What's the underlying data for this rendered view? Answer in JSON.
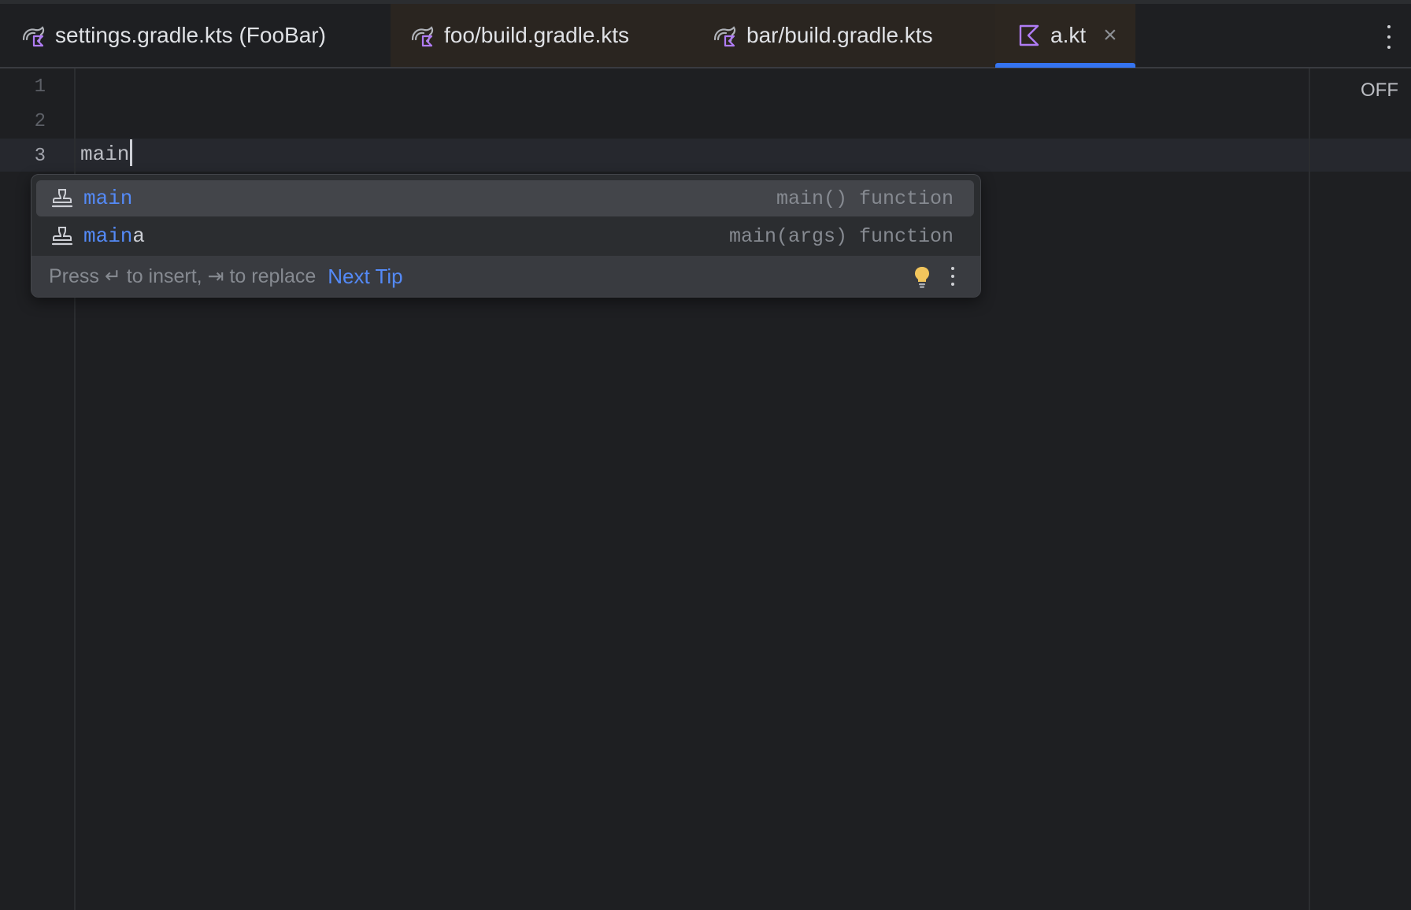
{
  "tabs": [
    {
      "label": "settings.gradle.kts (FooBar)",
      "icon": "gradle-kotlin-icon"
    },
    {
      "label": "foo/build.gradle.kts",
      "icon": "gradle-kotlin-icon"
    },
    {
      "label": "bar/build.gradle.kts",
      "icon": "gradle-kotlin-icon"
    },
    {
      "label": "a.kt",
      "icon": "kotlin-file-icon",
      "close": "×"
    }
  ],
  "editor": {
    "line_numbers": [
      "1",
      "2",
      "3"
    ],
    "current_line_text": "main",
    "status_label": "OFF"
  },
  "completion": {
    "items": [
      {
        "match": "main",
        "rest": "",
        "type_text": "main() function",
        "icon": "function-stamp-icon"
      },
      {
        "match": "main",
        "rest": "a",
        "type_text": "main(args) function",
        "icon": "function-stamp-icon"
      }
    ],
    "footer_text": "Press ↵ to insert, ⇥ to replace",
    "next_tip": "Next Tip"
  },
  "colors": {
    "accent": "#3574f0",
    "match": "#548af7",
    "background": "#1e1f22"
  }
}
